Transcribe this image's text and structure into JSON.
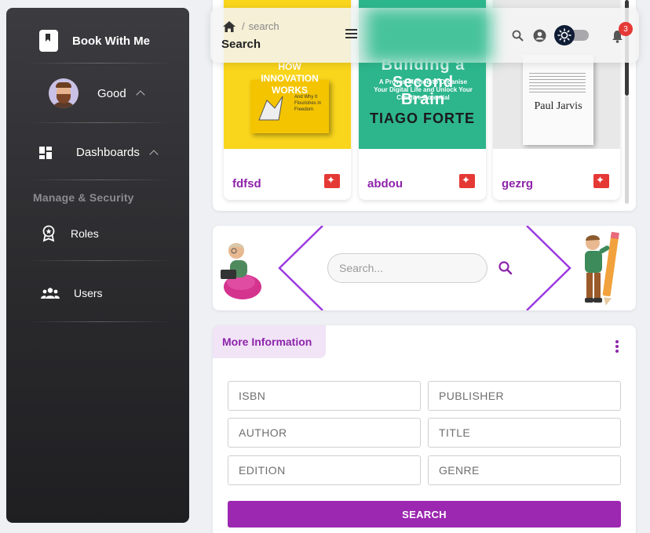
{
  "sidebar": {
    "brand": "Book With Me",
    "user": {
      "name": "Good"
    },
    "dashboards_label": "Dashboards",
    "section_title": "Manage & Security",
    "items": [
      {
        "label": "Roles",
        "icon": "badge-icon"
      },
      {
        "label": "Users",
        "icon": "group-icon"
      }
    ]
  },
  "navbar": {
    "breadcrumb": "search",
    "title": "Search",
    "notifications_count": "3"
  },
  "books": [
    {
      "name": "fdfsd",
      "cover": {
        "bg": "#f9d51c",
        "title": "HOW INNOVATION WORKS",
        "subtitle": "And Why It Flourishes in Freedom",
        "author": ""
      }
    },
    {
      "name": "abdou",
      "cover": {
        "bg": "#2db58c",
        "title": "Building a Second Brain",
        "subtitle": "A Proven Method to Organise Your Digital Life and Unlock Your Creative Potential",
        "author": "TIAGO FORTE"
      }
    },
    {
      "name": "gezrg",
      "cover": {
        "bg": "#e8e8e8",
        "title": "",
        "subtitle": "",
        "author": "Paul Jarvis"
      }
    }
  ],
  "search": {
    "placeholder": "Search..."
  },
  "info": {
    "tab_label": "More Information",
    "fields": {
      "isbn": "ISBN",
      "publisher": "PUBLISHER",
      "author": "AUTHOR",
      "title": "TITLE",
      "edition": "EDITION",
      "genre": "GENRE"
    },
    "submit_label": "SEARCH"
  },
  "colors": {
    "accent": "#9c27b0",
    "badge": "#e53935"
  }
}
